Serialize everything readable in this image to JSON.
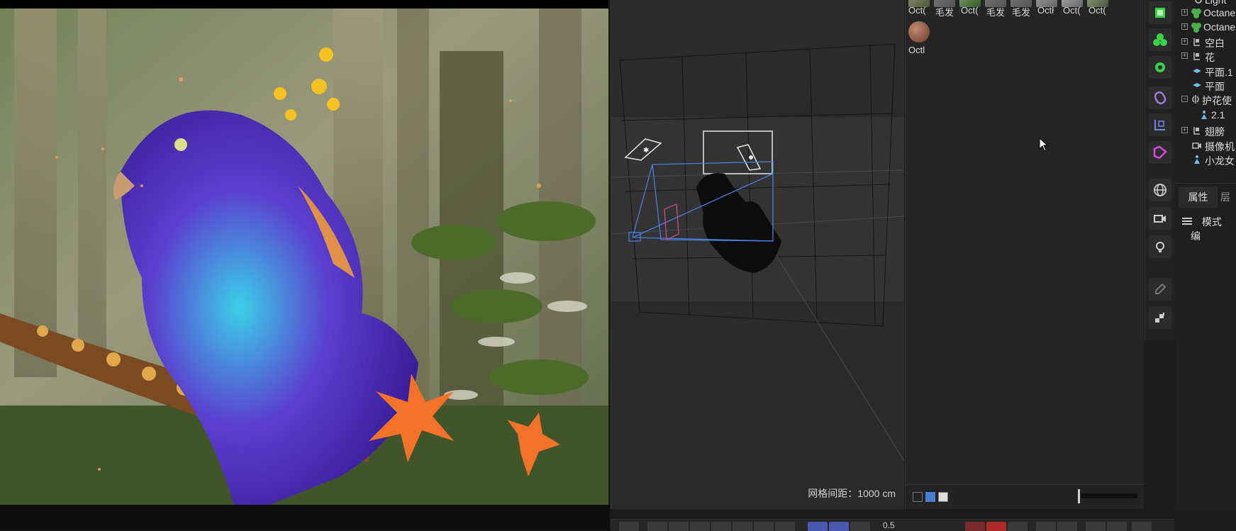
{
  "render_view": {
    "image_description_icon": "fluffy-bird-render"
  },
  "viewport": {
    "grid_spacing": "网格间距：1000 cm"
  },
  "materials": {
    "row1": [
      "Oct(",
      "毛发",
      "Oct(",
      "毛发",
      "毛发",
      "Octł",
      "Oct(",
      "Oct("
    ],
    "row2": [
      "Octl"
    ]
  },
  "palette": {
    "icons": [
      "cube-icon",
      "cluster-icon",
      "gear-generator-icon",
      "spline-icon",
      "axis-icon",
      "deformer-icon",
      "globe-icon",
      "camera-icon",
      "light-icon",
      "pen-icon",
      "steps-icon"
    ]
  },
  "object_manager": {
    "items": [
      {
        "label": "Light",
        "icon": "light-icon"
      },
      {
        "label": "Octane",
        "icon": "octane-icon"
      },
      {
        "label": "Octane",
        "icon": "octane-icon"
      },
      {
        "label": "空白",
        "icon": "null-icon"
      },
      {
        "label": "花",
        "icon": "null-icon"
      },
      {
        "label": "平面.1",
        "icon": "plane-icon"
      },
      {
        "label": "平面",
        "icon": "plane-icon"
      },
      {
        "label": "护花使",
        "icon": "symmetry-icon"
      },
      {
        "label": "2.1",
        "icon": "figure-icon"
      },
      {
        "label": "翅膀",
        "icon": "null-icon"
      },
      {
        "label": "摄像机",
        "icon": "camera-icon"
      },
      {
        "label": "小龙女",
        "icon": "figure-icon"
      }
    ]
  },
  "attributes": {
    "tab_active": "属性",
    "tab_2": "层",
    "mode_label": "模式",
    "mode_extra": "编"
  },
  "timeline": {
    "value": "0.5"
  },
  "colors": {
    "accent_blue": "#4a8cf0",
    "icon_green": "#3fd04a",
    "icon_magenta": "#d84ad8",
    "panel_bg": "#252525"
  }
}
